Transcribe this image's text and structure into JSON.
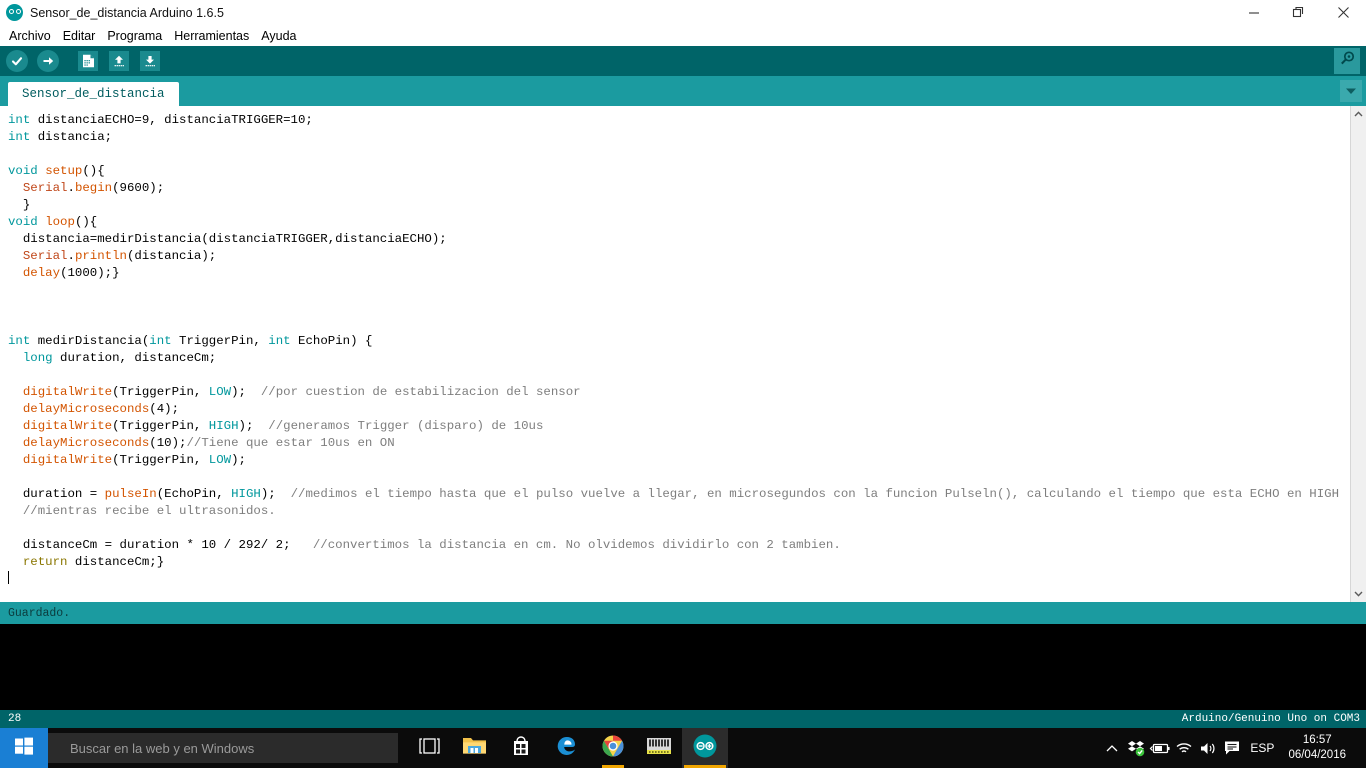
{
  "window": {
    "title": "Sensor_de_distancia Arduino 1.6.5",
    "app_icon": "arduino-logo-icon",
    "minimize_label": "—",
    "maximize_label": "❐",
    "close_label": "✕"
  },
  "menubar": {
    "items": [
      {
        "label": "Archivo"
      },
      {
        "label": "Editar"
      },
      {
        "label": "Programa"
      },
      {
        "label": "Herramientas"
      },
      {
        "label": "Ayuda"
      }
    ]
  },
  "toolbar": {
    "buttons": [
      {
        "name": "verify-button",
        "icon": "check-icon"
      },
      {
        "name": "upload-button",
        "icon": "arrow-right-icon"
      },
      {
        "name": "new-button",
        "icon": "new-document-icon"
      },
      {
        "name": "open-button",
        "icon": "arrow-up-icon"
      },
      {
        "name": "save-button",
        "icon": "arrow-down-icon"
      }
    ],
    "serial_monitor": {
      "name": "serial-monitor-button",
      "icon": "magnifier-icon"
    }
  },
  "tabs": {
    "active": "Sensor_de_distancia",
    "menu_icon": "chevron-down-icon"
  },
  "editor": {
    "lines": [
      [
        {
          "t": "int",
          "c": "kw"
        },
        {
          "t": " distanciaECHO=9, distanciaTRIGGER=10;",
          "c": ""
        }
      ],
      [
        {
          "t": "int",
          "c": "kw"
        },
        {
          "t": " distancia;",
          "c": ""
        }
      ],
      [
        {
          "t": "",
          "c": ""
        }
      ],
      [
        {
          "t": "void",
          "c": "kw"
        },
        {
          "t": " ",
          "c": ""
        },
        {
          "t": "setup",
          "c": "fn"
        },
        {
          "t": "(){",
          "c": ""
        }
      ],
      [
        {
          "t": "  ",
          "c": ""
        },
        {
          "t": "Serial",
          "c": "obj"
        },
        {
          "t": ".",
          "c": ""
        },
        {
          "t": "begin",
          "c": "fn"
        },
        {
          "t": "(9600);",
          "c": ""
        }
      ],
      [
        {
          "t": "  }",
          "c": ""
        }
      ],
      [
        {
          "t": "void",
          "c": "kw"
        },
        {
          "t": " ",
          "c": ""
        },
        {
          "t": "loop",
          "c": "fn"
        },
        {
          "t": "(){",
          "c": ""
        }
      ],
      [
        {
          "t": "  distancia=medirDistancia(distanciaTRIGGER,distanciaECHO);",
          "c": ""
        }
      ],
      [
        {
          "t": "  ",
          "c": ""
        },
        {
          "t": "Serial",
          "c": "obj"
        },
        {
          "t": ".",
          "c": ""
        },
        {
          "t": "println",
          "c": "fn"
        },
        {
          "t": "(distancia);",
          "c": ""
        }
      ],
      [
        {
          "t": "  ",
          "c": ""
        },
        {
          "t": "delay",
          "c": "fn"
        },
        {
          "t": "(1000);}",
          "c": ""
        }
      ],
      [
        {
          "t": "",
          "c": ""
        }
      ],
      [
        {
          "t": "",
          "c": ""
        }
      ],
      [
        {
          "t": "",
          "c": ""
        }
      ],
      [
        {
          "t": "int",
          "c": "kw"
        },
        {
          "t": " medirDistancia(",
          "c": ""
        },
        {
          "t": "int",
          "c": "kw"
        },
        {
          "t": " TriggerPin, ",
          "c": ""
        },
        {
          "t": "int",
          "c": "kw"
        },
        {
          "t": " EchoPin) {",
          "c": ""
        }
      ],
      [
        {
          "t": "  ",
          "c": ""
        },
        {
          "t": "long",
          "c": "kw"
        },
        {
          "t": " duration, distanceCm;",
          "c": ""
        }
      ],
      [
        {
          "t": "",
          "c": ""
        }
      ],
      [
        {
          "t": "  ",
          "c": ""
        },
        {
          "t": "digitalWrite",
          "c": "fn"
        },
        {
          "t": "(TriggerPin, ",
          "c": ""
        },
        {
          "t": "LOW",
          "c": "cst"
        },
        {
          "t": ");  ",
          "c": ""
        },
        {
          "t": "//por cuestion de estabilizacion del sensor",
          "c": "cmt"
        }
      ],
      [
        {
          "t": "  ",
          "c": ""
        },
        {
          "t": "delayMicroseconds",
          "c": "fn"
        },
        {
          "t": "(4);",
          "c": ""
        }
      ],
      [
        {
          "t": "  ",
          "c": ""
        },
        {
          "t": "digitalWrite",
          "c": "fn"
        },
        {
          "t": "(TriggerPin, ",
          "c": ""
        },
        {
          "t": "HIGH",
          "c": "cst"
        },
        {
          "t": ");  ",
          "c": ""
        },
        {
          "t": "//generamos Trigger (disparo) de 10us",
          "c": "cmt"
        }
      ],
      [
        {
          "t": "  ",
          "c": ""
        },
        {
          "t": "delayMicroseconds",
          "c": "fn"
        },
        {
          "t": "(10);",
          "c": ""
        },
        {
          "t": "//Tiene que estar 10us en ON",
          "c": "cmt"
        }
      ],
      [
        {
          "t": "  ",
          "c": ""
        },
        {
          "t": "digitalWrite",
          "c": "fn"
        },
        {
          "t": "(TriggerPin, ",
          "c": ""
        },
        {
          "t": "LOW",
          "c": "cst"
        },
        {
          "t": ");",
          "c": ""
        }
      ],
      [
        {
          "t": "",
          "c": ""
        }
      ],
      [
        {
          "t": "  duration = ",
          "c": ""
        },
        {
          "t": "pulseIn",
          "c": "fn"
        },
        {
          "t": "(EchoPin, ",
          "c": ""
        },
        {
          "t": "HIGH",
          "c": "cst"
        },
        {
          "t": ");  ",
          "c": ""
        },
        {
          "t": "//medimos el tiempo hasta que el pulso vuelve a llegar, en microsegundos con la funcion Pulseln(), calculando el tiempo que esta ECHO en HIGH",
          "c": "cmt"
        }
      ],
      [
        {
          "t": "  ",
          "c": ""
        },
        {
          "t": "//mientras recibe el ultrasonidos.",
          "c": "cmt"
        }
      ],
      [
        {
          "t": "",
          "c": ""
        }
      ],
      [
        {
          "t": "  distanceCm = duration * 10 / 292/ 2;   ",
          "c": ""
        },
        {
          "t": "//convertimos la distancia en cm. No olvidemos dividirlo con 2 tambien.",
          "c": "cmt"
        }
      ],
      [
        {
          "t": "  ",
          "c": ""
        },
        {
          "t": "return",
          "c": "ret"
        },
        {
          "t": " distanceCm;}",
          "c": ""
        }
      ]
    ]
  },
  "status": {
    "message": "Guardado.",
    "line_number": "28",
    "board": "Arduino/Genuino Uno on COM3"
  },
  "taskbar": {
    "start_icon": "windows-logo-icon",
    "search_placeholder": "Buscar en la web y en Windows",
    "items": [
      {
        "name": "task-view-icon"
      },
      {
        "name": "file-explorer-icon"
      },
      {
        "name": "microsoft-store-icon"
      },
      {
        "name": "edge-browser-icon"
      },
      {
        "name": "chrome-browser-icon"
      },
      {
        "name": "arduino-board-icon"
      },
      {
        "name": "arduino-ide-icon"
      }
    ],
    "tray": {
      "show_hidden_icon": "chevron-up-icon",
      "dropbox_icon": "dropbox-icon",
      "battery_icon": "battery-icon",
      "wifi_icon": "wifi-icon",
      "volume_icon": "speaker-icon",
      "action_center_icon": "action-center-icon",
      "language": "ESP",
      "time": "16:57",
      "date": "06/04/2016"
    }
  },
  "colors": {
    "arduino_teal": "#006468",
    "arduino_light_teal": "#1b9ba0",
    "keyword": "#00979c",
    "function": "#d35400",
    "comment": "#7e7e7e",
    "start_blue": "#1a7fd4"
  }
}
